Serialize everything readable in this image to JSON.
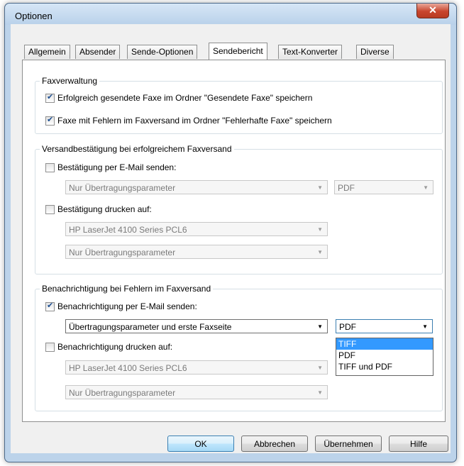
{
  "window": {
    "title": "Optionen",
    "close_label": "✕"
  },
  "tabs": [
    {
      "label": "Allgemein"
    },
    {
      "label": "Absender"
    },
    {
      "label": "Sende-Optionen"
    },
    {
      "label": "Sendebericht"
    },
    {
      "label": "Text-Konverter"
    },
    {
      "label": "Diverse"
    }
  ],
  "faxverwaltung": {
    "title": "Faxverwaltung",
    "cb1": {
      "label": "Erfolgreich gesendete Faxe im Ordner \"Gesendete Faxe\" speichern",
      "checked": true
    },
    "cb2": {
      "label": "Faxe mit Fehlern im Faxversand im Ordner \"Fehlerhafte Faxe\" speichern",
      "checked": true
    }
  },
  "versand": {
    "title": "Versandbestätigung bei erfolgreichem Faxversand",
    "email_cb": {
      "label": "Bestätigung per E-Mail senden:",
      "checked": false
    },
    "email_content": "Nur Übertragungsparameter",
    "email_format": "PDF",
    "print_cb": {
      "label": "Bestätigung drucken auf:",
      "checked": false
    },
    "printer": "HP LaserJet 4100 Series PCL6",
    "print_content": "Nur Übertragungsparameter"
  },
  "fehler": {
    "title": "Benachrichtigung bei Fehlern im Faxversand",
    "email_cb": {
      "label": "Benachrichtigung per E-Mail senden:",
      "checked": true
    },
    "email_content": "Übertragungsparameter und erste Faxseite",
    "email_format": "PDF",
    "format_options": [
      "TIFF",
      "PDF",
      "TIFF und PDF"
    ],
    "print_cb": {
      "label": "Benachrichtigung drucken auf:",
      "checked": false
    },
    "printer": "HP LaserJet 4100 Series PCL6",
    "print_content": "Nur Übertragungsparameter"
  },
  "buttons": {
    "ok": "OK",
    "cancel": "Abbrechen",
    "apply": "Übernehmen",
    "help": "Hilfe"
  }
}
